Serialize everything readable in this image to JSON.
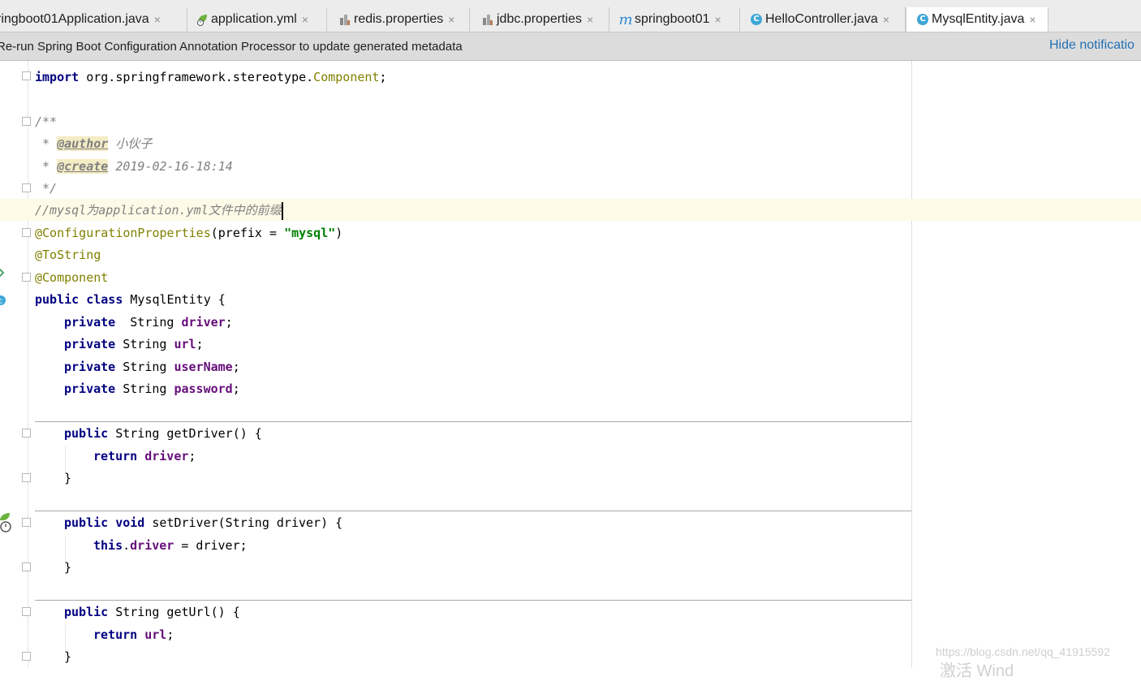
{
  "tabs": [
    {
      "label": "ringboot01Application.java",
      "icon": "java-class-icon"
    },
    {
      "label": "application.yml",
      "icon": "spring-boot-icon"
    },
    {
      "label": "redis.properties",
      "icon": "properties-file-icon"
    },
    {
      "label": "jdbc.properties",
      "icon": "properties-file-icon"
    },
    {
      "label": "springboot01",
      "icon": "maven-icon",
      "glyph": "m"
    },
    {
      "label": "HelloController.java",
      "icon": "class-icon",
      "glyph": "C"
    },
    {
      "label": "MysqlEntity.java",
      "icon": "class-icon",
      "glyph": "C"
    }
  ],
  "close_glyph": "×",
  "notification": {
    "message": "Re-run Spring Boot Configuration Annotation Processor to update generated metadata",
    "action": "Hide notificatio"
  },
  "code": {
    "import_kw": "import",
    "import_pkg": " org.springframework.stereotype.",
    "import_cls": "Component",
    "semi": ";",
    "doc_open": "/**",
    "doc_star": " * ",
    "author_tag": "@author",
    "author_val": " 小伙子",
    "create_tag": "@create",
    "create_val": " 2019-02-16-18:14",
    "doc_close": " */",
    "line_comment": "//mysql为application.yml文件中的前缀",
    "cfg_ann": "@ConfigurationProperties",
    "cfg_open": "(prefix = ",
    "cfg_str": "\"mysql\"",
    "cfg_close": ")",
    "tostring_ann": "@ToString",
    "component_ann": "@Component",
    "class_kw": "public class",
    "class_rest": " MysqlEntity {",
    "private_kw": "private",
    "f1_type": "  String ",
    "f1_name": "driver",
    "f_type": " String ",
    "f2_name": "url",
    "f3_name": "userName",
    "f4_name": "password",
    "public_kw": "public",
    "return_kw": "return",
    "void_kw": "void",
    "this_kw": "this",
    "get_driver_sig": " String getDriver() {",
    "set_driver_sig": " setDriver(String driver) {",
    "set_driver_rest": " = driver;",
    "get_url_sig": " String getUrl() {",
    "close_brace": "}",
    "dot": ".",
    "space": " "
  },
  "watermark": {
    "url": "https://blog.csdn.net/qq_41915592",
    "activate": "激活 Wind"
  },
  "colors": {
    "keyword": "#000080",
    "annotation": "#808000",
    "string": "#008000",
    "field": "#660e7a",
    "comment": "#808080",
    "link": "#2470b3"
  }
}
